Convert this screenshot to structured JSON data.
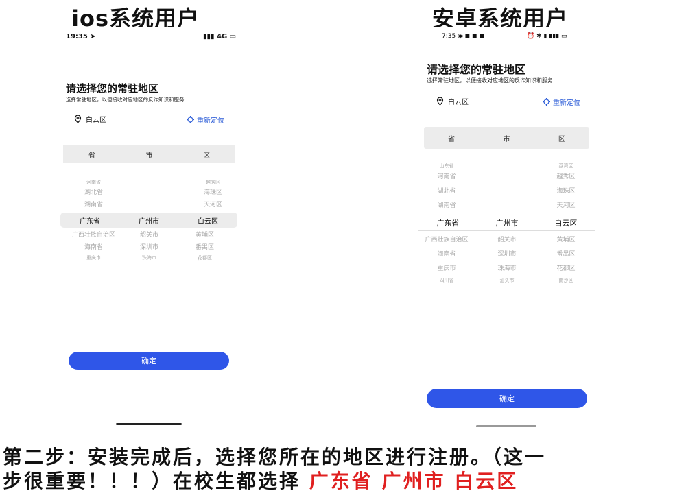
{
  "headings": {
    "ios": "ios系统用户",
    "android": "安卓系统用户"
  },
  "ios": {
    "status_time": "19:35",
    "status_net": "4G",
    "title": "请选择您的常驻地区",
    "subtitle": "选择常驻地区，以便接收对应地区的反诈知识和服务",
    "location": "白云区",
    "relocate": "重新定位",
    "headers": [
      "省",
      "市",
      "区"
    ],
    "provinces_above": [
      "河南省",
      "湖北省",
      "湖南省"
    ],
    "selected": [
      "广东省",
      "广州市",
      "白云区"
    ],
    "provinces_below": [
      "广西壮族自治区",
      "海南省",
      "重庆市"
    ],
    "districts_above": [
      "越秀区",
      "海珠区",
      "天河区"
    ],
    "districts_below": [
      "黄埔区",
      "番禺区",
      "花都区"
    ],
    "cities_below": [
      "韶关市",
      "深圳市",
      "珠海市"
    ],
    "confirm": "确定"
  },
  "android": {
    "status_time": "7:35",
    "title": "请选择您的常驻地区",
    "subtitle": "选择常驻地区，以便接收对应地区的反诈知识和服务",
    "location": "白云区",
    "relocate": "重新定位",
    "headers": [
      "省",
      "市",
      "区"
    ],
    "provinces_above": [
      "山东省",
      "河南省",
      "湖北省",
      "湖南省"
    ],
    "selected": [
      "广东省",
      "广州市",
      "白云区"
    ],
    "provinces_below": [
      "广西壮族自治区",
      "海南省",
      "重庆市",
      "四川省"
    ],
    "districts_above": [
      "荔湾区",
      "越秀区",
      "海珠区",
      "天河区"
    ],
    "districts_below": [
      "黄埔区",
      "番禺区",
      "花都区",
      "南沙区"
    ],
    "cities_below": [
      "韶关市",
      "深圳市",
      "珠海市",
      "汕头市"
    ],
    "confirm": "确定"
  },
  "footer": {
    "line1": "第二步：安装完成后，选择您所在的地区进行注册。（这一",
    "line2_prefix": "步很重要！！！）在校生都选择",
    "line2_highlight": "广东省 广州市 白云区"
  }
}
